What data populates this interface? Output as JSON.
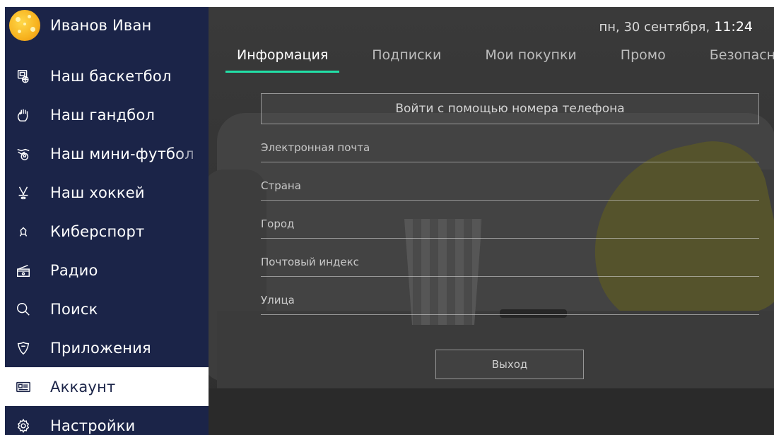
{
  "profile": {
    "name": "Иванов Иван"
  },
  "sidebar": {
    "items": [
      {
        "label": "Наш баскетбол",
        "icon": "basketball-icon"
      },
      {
        "label": "Наш гандбол",
        "icon": "handball-icon"
      },
      {
        "label": "Наш мини-футбол",
        "icon": "minifootball-icon"
      },
      {
        "label": "Наш хоккей",
        "icon": "hockey-icon"
      },
      {
        "label": "Киберспорт",
        "icon": "esports-icon"
      },
      {
        "label": "Радио",
        "icon": "radio-icon"
      },
      {
        "label": "Поиск",
        "icon": "search-icon"
      },
      {
        "label": "Приложения",
        "icon": "apps-icon"
      },
      {
        "label": "Аккаунт",
        "icon": "account-icon",
        "active": true
      },
      {
        "label": "Настройки",
        "icon": "settings-icon"
      }
    ]
  },
  "header": {
    "date": "пн, 30 сентября,",
    "time": "11:24",
    "tabs": [
      {
        "label": "Информация",
        "active": true
      },
      {
        "label": "Подписки"
      },
      {
        "label": "Мои покупки"
      },
      {
        "label": "Промо"
      },
      {
        "label": "Безопасность"
      }
    ]
  },
  "form": {
    "phone_login_label": "Войти с помощью номера телефона",
    "fields": [
      {
        "placeholder": "Электронная почта",
        "value": ""
      },
      {
        "placeholder": "Страна",
        "value": ""
      },
      {
        "placeholder": "Город",
        "value": ""
      },
      {
        "placeholder": "Почтовый индекс",
        "value": ""
      },
      {
        "placeholder": "Улица",
        "value": ""
      }
    ],
    "logout_label": "Выход"
  },
  "colors": {
    "sidebar_bg": "#1b2448",
    "active_item_bg": "#ffffff",
    "tab_accent": "#22e0a7"
  }
}
